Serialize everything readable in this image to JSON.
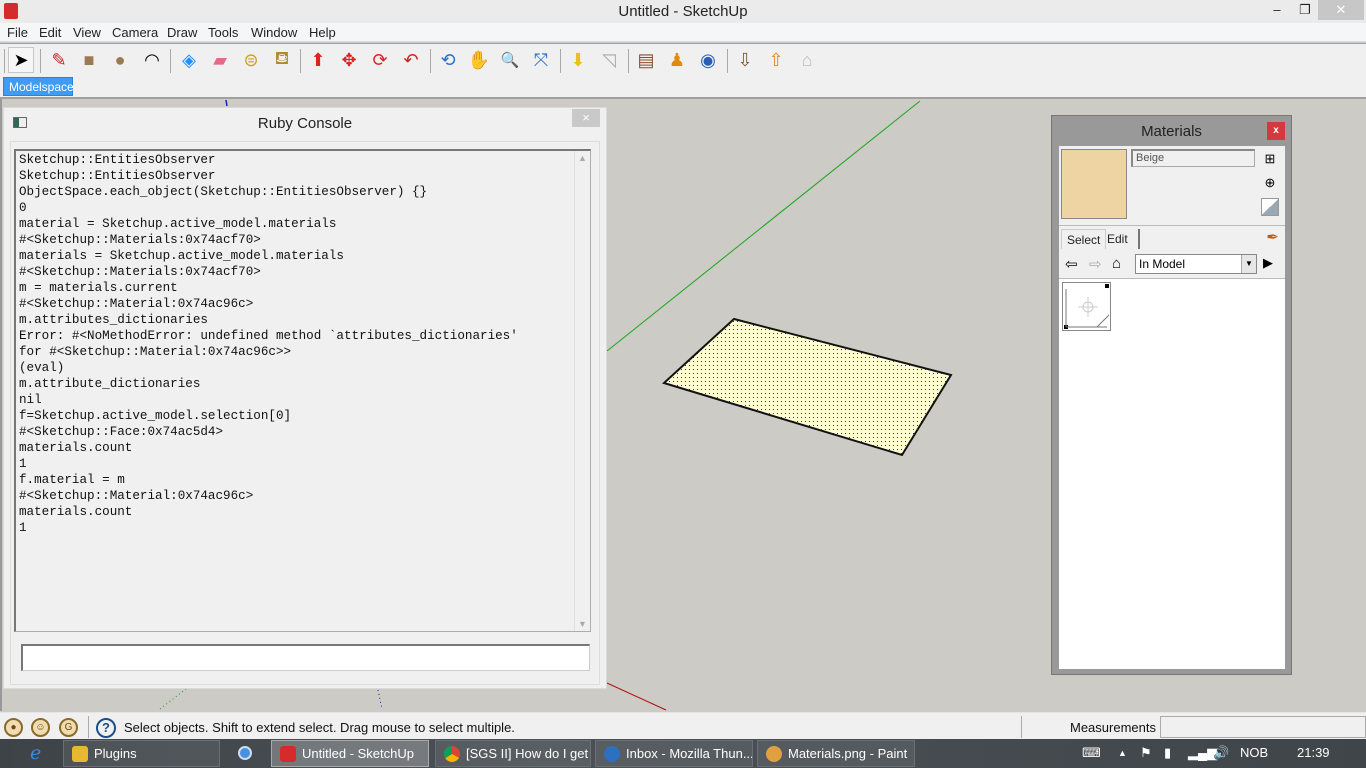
{
  "window": {
    "title": "Untitled - SketchUp",
    "controls": {
      "minimize": "‒",
      "restore": "❐",
      "close": "✕"
    }
  },
  "menu": [
    "File",
    "Edit",
    "View",
    "Camera",
    "Draw",
    "Tools",
    "Window",
    "Help"
  ],
  "toolbar": {
    "tools": [
      {
        "name": "select-tool-icon",
        "glyph": "➤",
        "active": true
      },
      {
        "name": "pencil-icon",
        "glyph": "✎"
      },
      {
        "name": "rectangle-icon",
        "glyph": "■"
      },
      {
        "name": "circle-icon",
        "glyph": "●"
      },
      {
        "name": "arc-icon",
        "glyph": "◠"
      },
      {
        "name": "make-component-icon",
        "glyph": "◈"
      },
      {
        "name": "eraser-icon",
        "glyph": "▰"
      },
      {
        "name": "tape-measure-icon",
        "glyph": "⊜"
      },
      {
        "name": "paint-bucket-icon",
        "glyph": "⛾"
      },
      {
        "name": "push-pull-icon",
        "glyph": "⬆"
      },
      {
        "name": "move-icon",
        "glyph": "✥"
      },
      {
        "name": "rotate-icon",
        "glyph": "⟳"
      },
      {
        "name": "follow-me-icon",
        "glyph": "↶"
      },
      {
        "name": "orbit-icon",
        "glyph": "⟲"
      },
      {
        "name": "pan-icon",
        "glyph": "✋"
      },
      {
        "name": "zoom-icon",
        "glyph": "🔍"
      },
      {
        "name": "zoom-extents-icon",
        "glyph": "⤧"
      },
      {
        "name": "add-location-icon",
        "glyph": "⬇"
      },
      {
        "name": "toggle-terrain-icon",
        "glyph": "◹"
      },
      {
        "name": "photo-textures-icon",
        "glyph": "▤"
      },
      {
        "name": "street-view-icon",
        "glyph": "♟"
      },
      {
        "name": "google-earth-icon",
        "glyph": "◉"
      },
      {
        "name": "get-models-icon",
        "glyph": "⇩"
      },
      {
        "name": "share-model-icon",
        "glyph": "⇧"
      },
      {
        "name": "share-component-icon",
        "glyph": "⌂"
      }
    ]
  },
  "scene_tabs": [
    "Modelspace"
  ],
  "ruby_console": {
    "title": "Ruby Console",
    "close": "×",
    "output": [
      "Sketchup::EntitiesObserver",
      "Sketchup::EntitiesObserver",
      "ObjectSpace.each_object(Sketchup::EntitiesObserver) {}",
      "0",
      "material = Sketchup.active_model.materials",
      "#<Sketchup::Materials:0x74acf70>",
      "materials = Sketchup.active_model.materials",
      "#<Sketchup::Materials:0x74acf70>",
      "m = materials.current",
      "#<Sketchup::Material:0x74ac96c>",
      "m.attributes_dictionaries",
      "Error: #<NoMethodError: undefined method `attributes_dictionaries'",
      "for #<Sketchup::Material:0x74ac96c>>",
      "(eval)",
      "m.attribute_dictionaries",
      "nil",
      "f=Sketchup.active_model.selection[0]",
      "#<Sketchup::Face:0x74ac5d4>",
      "materials.count",
      "1",
      "f.material = m",
      "#<Sketchup::Material:0x74ac96c>",
      "materials.count",
      "1"
    ],
    "input_value": ""
  },
  "materials_panel": {
    "title": "Materials",
    "close": "x",
    "current_material": "Beige",
    "swatch_color": "#eed4a2",
    "tabs": [
      "Select",
      "Edit"
    ],
    "library": "In Model"
  },
  "statusbar": {
    "message": "Select objects. Shift to extend select. Drag mouse to select multiple.",
    "measurements_label": "Measurements",
    "measurements_value": "",
    "help": "?"
  },
  "taskbar": {
    "items": [
      {
        "label": "Plugins",
        "color": "#e8b830",
        "active": false
      },
      {
        "label": "Untitled - SketchUp",
        "color": "#d62b2b",
        "active": true
      },
      {
        "label": "[SGS II] How do I get ...",
        "color": "#3cae4c",
        "active": false
      },
      {
        "label": "Inbox - Mozilla Thun...",
        "color": "#2f6fbf",
        "active": false
      },
      {
        "label": "Materials.png - Paint",
        "color": "#e0a040",
        "active": false
      }
    ],
    "language": "NOB",
    "clock": "21:39"
  }
}
